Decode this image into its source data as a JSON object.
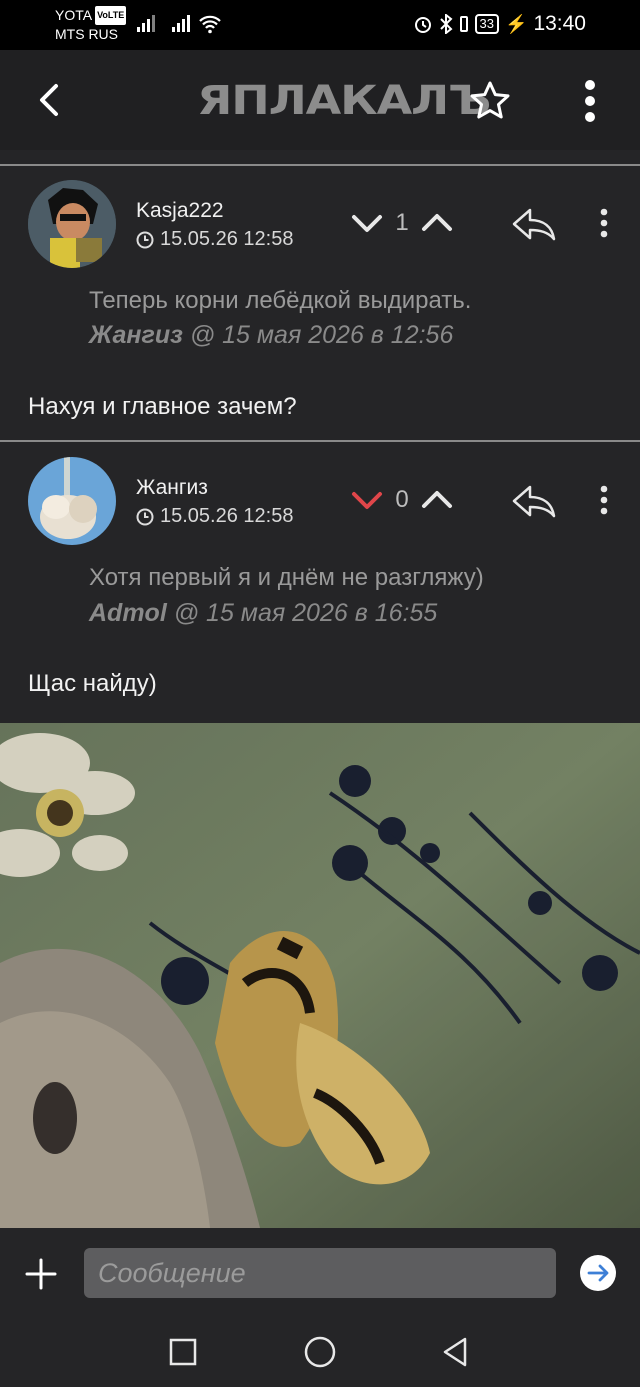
{
  "status_bar": {
    "carrier_1": "YOTA",
    "carrier_1_badge": "VoLTE",
    "carrier_2": "MTS RUS",
    "battery": "33",
    "time": "13:40"
  },
  "app_bar": {
    "logo": "ЯПЛАКАЛЪ"
  },
  "comments": [
    {
      "author": "Kasja222",
      "date": "15.05.26 12:58",
      "score": "1",
      "quote_text": "Теперь корни лебёдкой выдирать.",
      "quote_author": "Жангиз",
      "quote_meta": " @ 15 мая 2026 в 12:56",
      "text": "Нахуя и главное зачем?"
    },
    {
      "author": "Жангиз",
      "date": "15.05.26 12:58",
      "score": "0",
      "quote_text": "Хотя первый я и днём не разгляжу)",
      "quote_author": "Admol",
      "quote_meta": " @ 15 мая 2026 в 16:55",
      "text": "Щас найду)"
    }
  ],
  "composer": {
    "placeholder": "Сообщение"
  },
  "colors": {
    "background": "#252527",
    "downvote_active": "#e0464a",
    "send": "#ffffff"
  }
}
